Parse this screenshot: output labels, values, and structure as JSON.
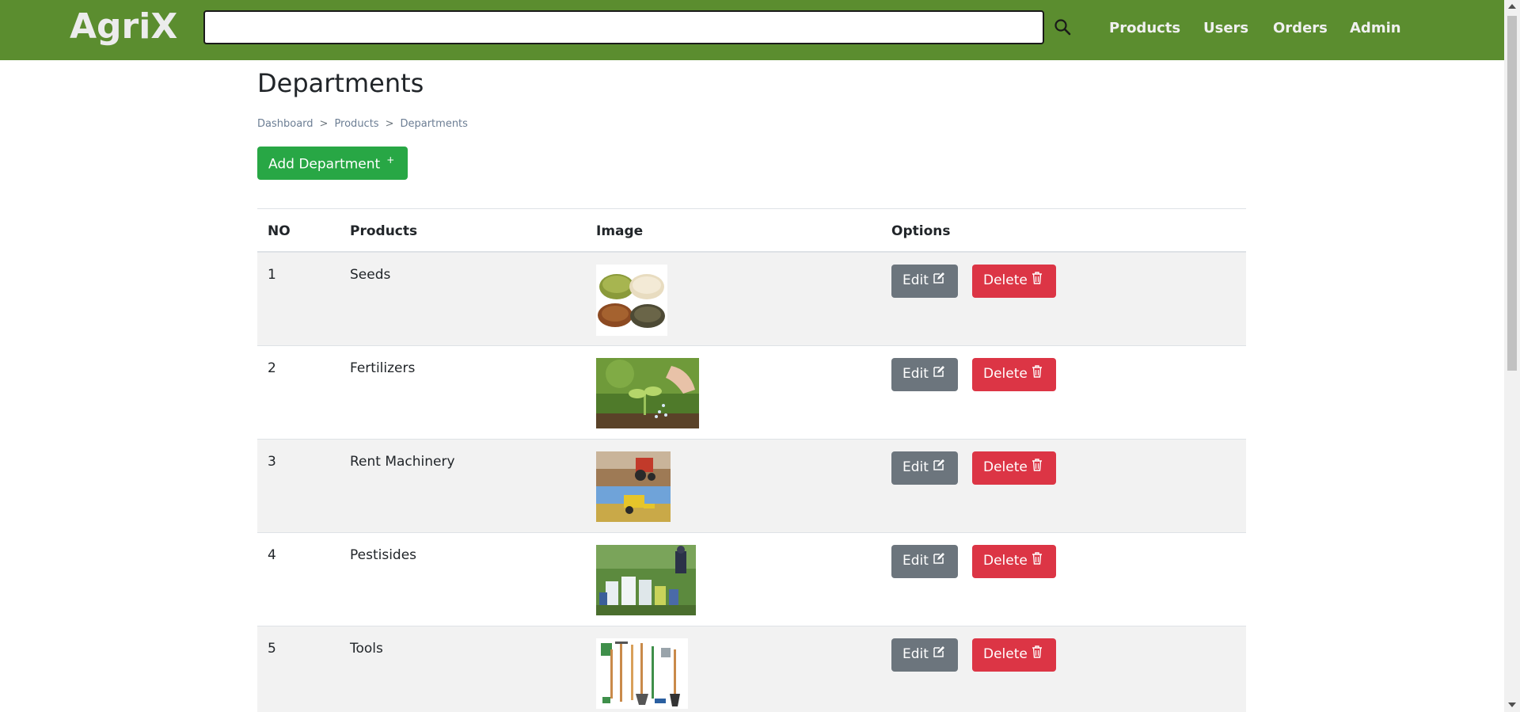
{
  "header": {
    "brand": "AgriX",
    "search": {
      "value": "",
      "placeholder": ""
    },
    "nav": [
      "Products",
      "Users",
      "Orders",
      "Admin"
    ],
    "bg_color": "#5b8d2f"
  },
  "page": {
    "title": "Departments",
    "breadcrumb": [
      "Dashboard",
      "Products",
      "Departments"
    ],
    "breadcrumb_sep": ">",
    "add_button": "Add Department",
    "add_button_icon": "+"
  },
  "table": {
    "headers": [
      "NO",
      "Products",
      "Image",
      "Options"
    ],
    "rows": [
      {
        "no": "1",
        "product": "Seeds",
        "image": "seeds-image"
      },
      {
        "no": "2",
        "product": "Fertilizers",
        "image": "fertilizers-image"
      },
      {
        "no": "3",
        "product": "Rent Machinery",
        "image": "machinery-image"
      },
      {
        "no": "4",
        "product": "Pestisides",
        "image": "pesticides-image"
      },
      {
        "no": "5",
        "product": "Tools",
        "image": "tools-image"
      }
    ],
    "edit_label": "Edit",
    "delete_label": "Delete",
    "colors": {
      "add": "#28a745",
      "edit": "#6c757d",
      "delete": "#dc3545"
    }
  }
}
